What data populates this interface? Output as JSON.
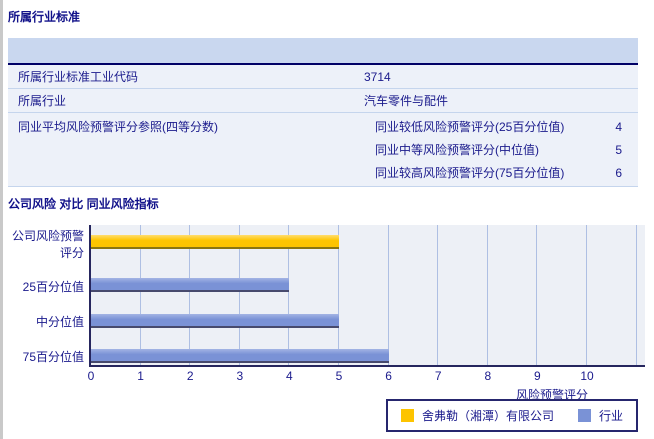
{
  "industry_section": {
    "title": "所属行业标准",
    "rows": [
      {
        "label": "所属行业标准工业代码",
        "value": "3714"
      },
      {
        "label": "所属行业",
        "value": "汽车零件与配件"
      }
    ],
    "quartile": {
      "label": "同业平均风险预警评分参照(四等分数)",
      "items": [
        {
          "label": "同业较低风险预警评分(25百分位值)",
          "value": "4"
        },
        {
          "label": "同业中等风险预警评分(中位值)",
          "value": "5"
        },
        {
          "label": "同业较高风险预警评分(75百分位值)",
          "value": "6"
        }
      ]
    }
  },
  "comparison_section": {
    "title": "公司风险 对比 同业风险指标"
  },
  "chart_data": {
    "type": "bar",
    "orientation": "horizontal",
    "title": "公司风险 对比 同业风险指标",
    "categories": [
      "公司风险预警评分",
      "25百分位值",
      "中分位值",
      "75百分位值"
    ],
    "values": [
      5,
      4,
      5,
      6
    ],
    "bar_series": [
      "company",
      "industry",
      "industry",
      "industry"
    ],
    "colors": {
      "company": "#fdc400",
      "industry": "#7a92d6"
    },
    "xlabel": "风险预警评分",
    "xlim": [
      0,
      11
    ],
    "xticks": [
      0,
      1,
      2,
      3,
      4,
      5,
      6,
      7,
      8,
      9,
      10
    ],
    "grid": "vertical",
    "legend_position": "bottom-right",
    "legend": [
      {
        "name": "舍弗勒（湘潭）有限公司",
        "series": "company",
        "color": "#fdc400"
      },
      {
        "name": "行业",
        "series": "industry",
        "color": "#7a92d6"
      }
    ]
  }
}
